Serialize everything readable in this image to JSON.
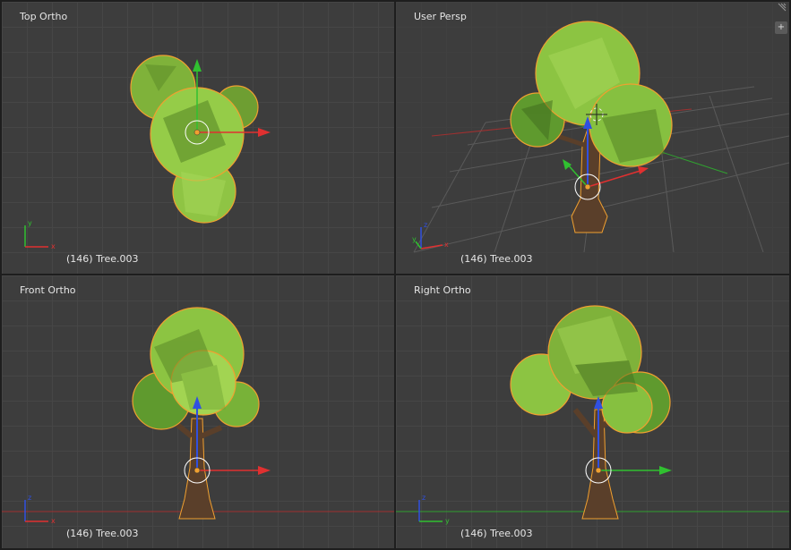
{
  "viewports": [
    {
      "id": "top",
      "label": "Top Ortho",
      "object": "(146) Tree.003",
      "axes": [
        "x",
        "y"
      ]
    },
    {
      "id": "user",
      "label": "User Persp",
      "object": "(146) Tree.003",
      "axes": [
        "x",
        "y",
        "z"
      ]
    },
    {
      "id": "front",
      "label": "Front Ortho",
      "object": "(146) Tree.003",
      "axes": [
        "x",
        "z"
      ]
    },
    {
      "id": "right",
      "label": "Right Ortho",
      "object": "(146) Tree.003",
      "axes": [
        "y",
        "z"
      ]
    }
  ],
  "controls": {
    "plus_icon": "+"
  },
  "colors": {
    "foliage_light": "#a8d85a",
    "foliage_mid": "#7fb23a",
    "foliage_dark": "#4f7d22",
    "trunk": "#5a3f2a",
    "select_outline": "#f0a030",
    "x_axis": "#e03030",
    "y_axis": "#30c030",
    "z_axis": "#3050e0"
  }
}
